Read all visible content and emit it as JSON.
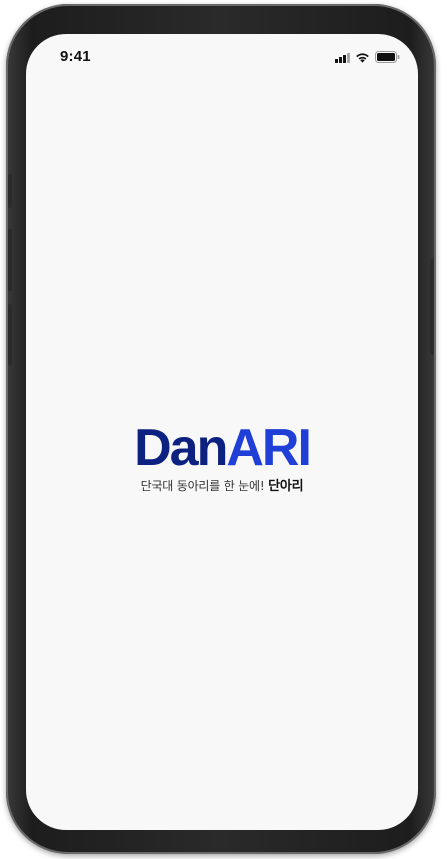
{
  "status_bar": {
    "time": "9:41",
    "icons": [
      "cellular-signal-icon",
      "wifi-icon",
      "battery-icon"
    ]
  },
  "splash": {
    "logo_part_1": "Dan",
    "logo_part_2": "ARI",
    "tagline": "단국대 동아리를 한 눈에!",
    "tagline_strong": "단아리"
  },
  "colors": {
    "logo_dark": "#0d2280",
    "logo_bright": "#1f3fd6",
    "screen_background": "#f8f8f8",
    "frame": "#1d1d1d"
  }
}
